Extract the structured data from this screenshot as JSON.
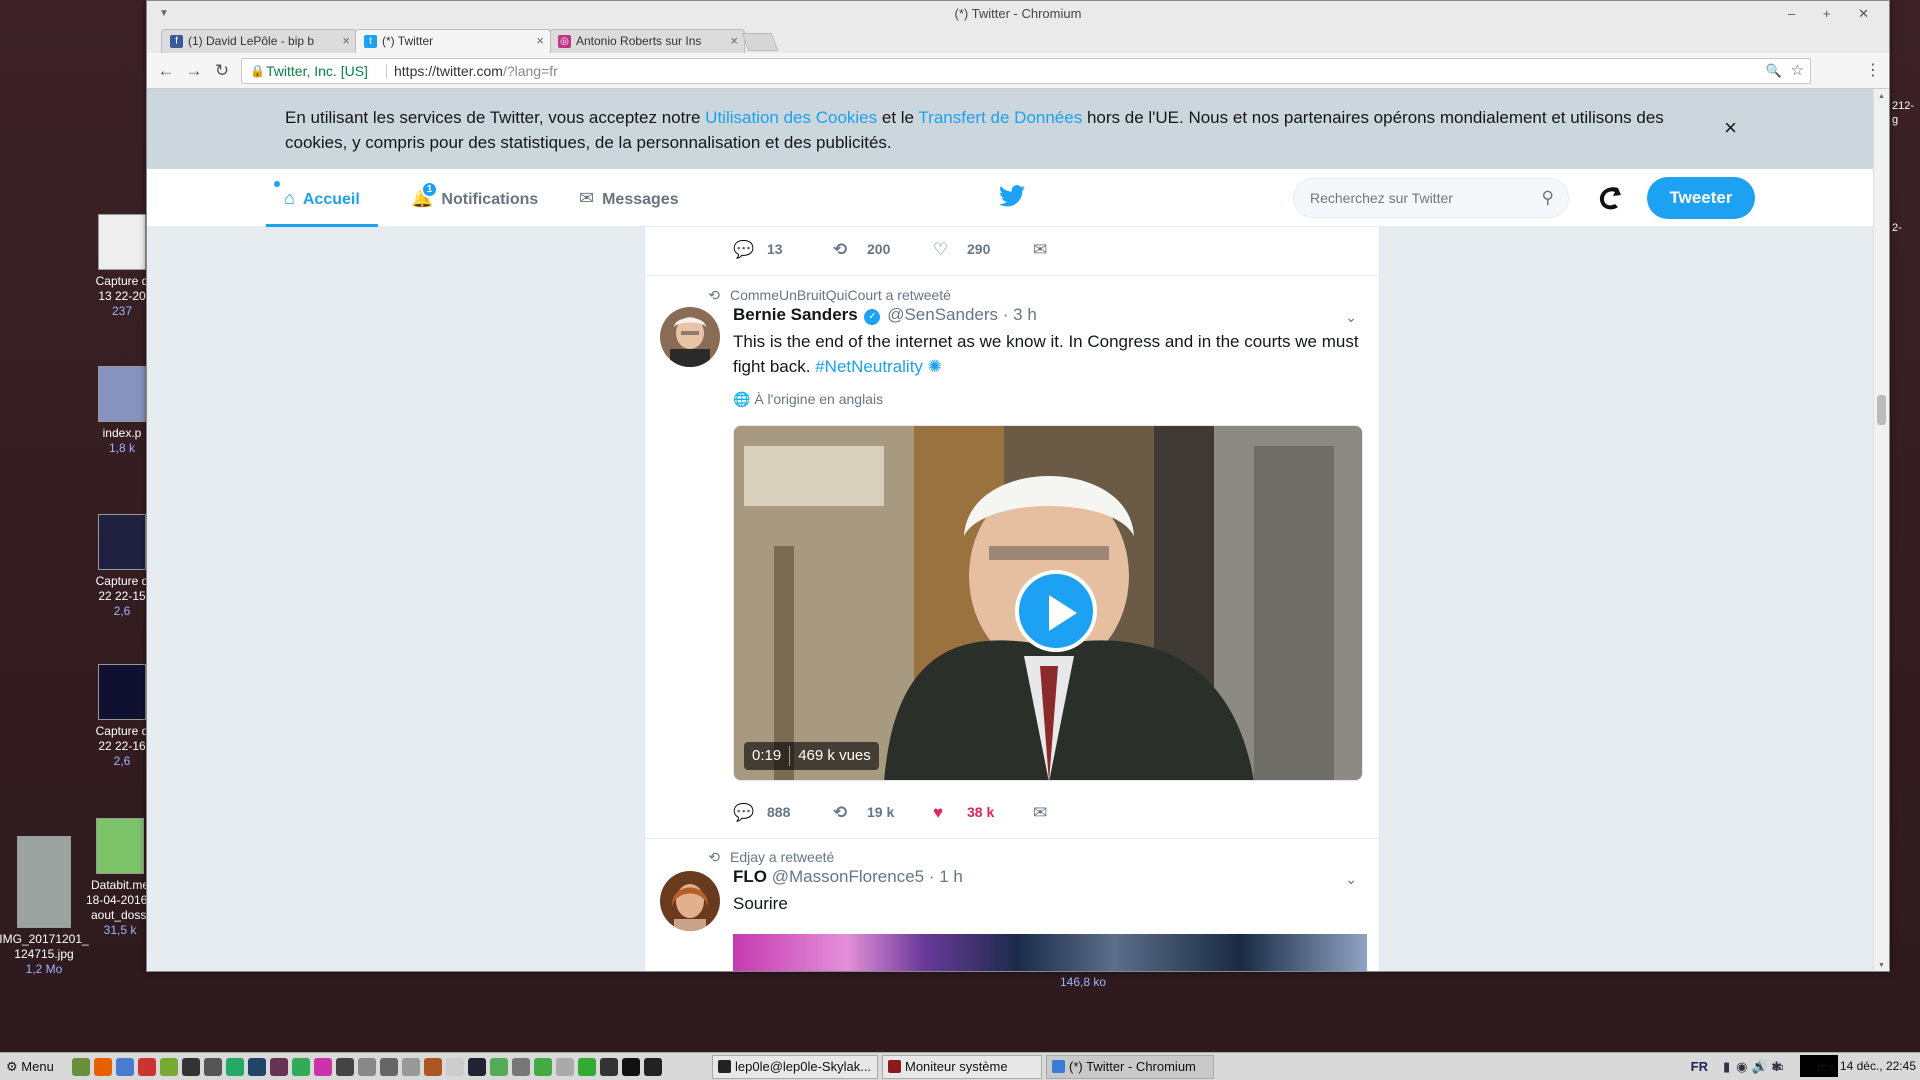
{
  "desktop": {
    "icons": [
      {
        "label": "Capture d",
        "line2": "13 22-20",
        "size": "237"
      },
      {
        "label": "index.p",
        "line2": "",
        "size": "1,8 k"
      },
      {
        "label": "Capture d",
        "line2": "22 22-15",
        "size": "2,6"
      },
      {
        "label": "Capture d",
        "line2": "22 22-16",
        "size": "2,6"
      },
      {
        "label": "Databit.me",
        "line2": "18-04-2016_ aout_dossi",
        "size": "31,5 k"
      },
      {
        "label": "IMG_20171201_",
        "line2": "124715.jpg",
        "size": "1,2 Mo"
      }
    ],
    "bottom_size": "146,8 ko",
    "right_edge_text_1": "212-",
    "right_edge_text_2": "g",
    "right_edge_text_3": "2-"
  },
  "window": {
    "title": "(*) Twitter - Chromium",
    "controls": "– + ✕"
  },
  "tabs": [
    {
      "title": "(1) David LePôle - bip b",
      "icon_color": "#3b5998",
      "icon_glyph": "f",
      "active": false
    },
    {
      "title": "(*) Twitter",
      "icon_color": "#1da1f2",
      "icon_glyph": "t",
      "active": true
    },
    {
      "title": "Antonio Roberts sur Ins",
      "icon_color": "#c13584",
      "icon_glyph": "◎",
      "active": false
    }
  ],
  "toolbar": {
    "back": "←",
    "forward": "→",
    "reload": "↻",
    "secure_label": "Twitter, Inc. [US]",
    "url_main": "https://twitter.com",
    "url_rest": "/?lang=fr",
    "zoom_icon": "🔍",
    "star_icon": "☆",
    "menu_icon": "⋮"
  },
  "cookie_banner": {
    "text_1": "En utilisant les services de Twitter, vous acceptez notre ",
    "link_1": "Utilisation des Cookies",
    "text_2": " et le ",
    "link_2": "Transfert de Données",
    "text_3": " hors de l'UE. Nous et nos partenaires opérons mondialement et utilisons des cookies, y compris pour des statistiques, de la personnalisation et des publicités.",
    "close": "×"
  },
  "twitter_nav": {
    "home": "Accueil",
    "notifications": "Notifications",
    "notifications_badge": "1",
    "messages": "Messages",
    "search_placeholder": "Recherchez sur Twitter",
    "tweet_button": "Tweeter"
  },
  "timeline": {
    "prev_tweet_actions": {
      "replies": "13",
      "retweets": "200",
      "likes": "290"
    },
    "tweets": [
      {
        "retweet_context": "CommeUnBruitQuiCourt a retweeté",
        "name": "Bernie Sanders",
        "handle": "@SenSanders",
        "time": "· 3 h",
        "text": "This is the end of the internet as we know it. In Congress and in the courts we must fight back. ",
        "hashtag": "#NetNeutrality",
        "translated_label": "À l'origine en anglais",
        "video_duration": "0:19",
        "video_views": "469 k vues",
        "actions": {
          "replies": "888",
          "retweets": "19 k",
          "likes": "38 k"
        }
      },
      {
        "retweet_context": "Edjay a retweeté",
        "name": "FLO",
        "handle": "@MassonFlorence5",
        "time": "· 1 h",
        "text": "Sourire"
      }
    ]
  },
  "taskbar": {
    "menu": "Menu",
    "tasks": [
      {
        "label": "lep0le@lep0le-Skylak...",
        "icon_color": "#222"
      },
      {
        "label": "Moniteur système",
        "icon_color": "#8b1a1a"
      },
      {
        "label": "(*) Twitter - Chromium",
        "icon_color": "#3a7bd5"
      }
    ],
    "lang": "FR",
    "clock": "jeu. 14 déc., 22:45"
  }
}
